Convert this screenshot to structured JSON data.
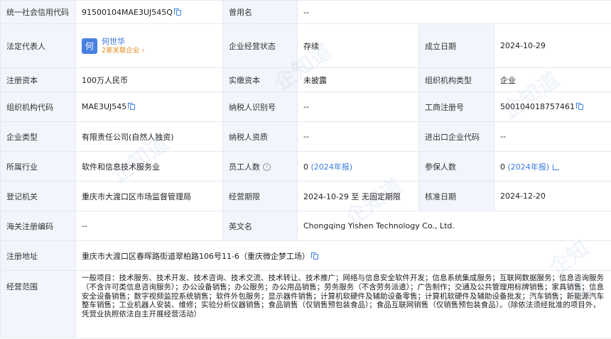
{
  "rows": [
    {
      "l1": "统一社会信用代码",
      "v1": "91500104MAE3UJ545Q",
      "l2": "曾用名",
      "v2": "--"
    },
    {
      "l1": "法定代表人",
      "rep_avatar": "何",
      "rep_name": "何世华",
      "rep_rel": "2家关联企业 ›",
      "l2": "企业经营状态",
      "v2": "存续",
      "l3": "成立日期",
      "v3": "2024-10-29"
    },
    {
      "l1": "注册资本",
      "v1": "100万人民币",
      "l2": "实缴资本",
      "v2": "未披露",
      "l3": "组织机构类型",
      "v3": "企业"
    },
    {
      "l1": "组织机构代码",
      "v1": "MAE3UJ545",
      "l2": "纳税人识别号",
      "v2": "--",
      "l3": "工商注册号",
      "v3": "500104018757461"
    },
    {
      "l1": "企业类型",
      "v1": "有限责任公司(自然人独资)",
      "l2": "纳税人资质",
      "v2": "--",
      "l3": "进出口企业代码",
      "v3": "--"
    },
    {
      "l1": "所属行业",
      "v1": "软件和信息技术服务业",
      "l2": "员工人数",
      "v2": "0",
      "v2_link": "(2024年报)",
      "l3": "参保人数",
      "v3": "0",
      "v3_link": "(2024年报)"
    },
    {
      "l1": "登记机关",
      "v1": "重庆市大渡口区市场监督管理局",
      "l2": "经营期限",
      "v2": "2024-10-29 至 无固定期限",
      "l3": "核准日期",
      "v3": "2024-12-20"
    },
    {
      "l1": "海关注册编码",
      "v1": "--",
      "l2": "英文名",
      "v2": "Chongqing Yishen Technology Co., Ltd."
    },
    {
      "l1": "注册地址",
      "v1": "重庆市大渡口区春晖路街道翠柏路106号11-6（重庆微企梦工场）"
    },
    {
      "l1": "经营范围",
      "v1": "一般项目：技术服务、技术开发、技术咨询、技术交流、技术转让、技术推广；网络与信息安全软件开发；信息系统集成服务；互联网数据服务；信息咨询服务（不含许可类信息咨询服务）；办公设备销售；办公服务；办公用品销售；劳务服务（不含劳务派遣）；广告制作；交通及公共管理用标牌销售；家具销售；信息安全设备销售；数字视频监控系统销售；软件外包服务；显示器件销售；计算机软硬件及辅助设备零售；计算机软硬件及辅助设备批发；汽车销售；新能源汽车整车销售；工业机器人安装、维修；实验分析仪器销售；食品销售（仅销售预包装食品）；食品互联网销售（仅销售预包装食品）。（除依法须经批准的项目外，凭营业执照依法自主开展经营活动）"
    }
  ],
  "watermark": "企知道"
}
